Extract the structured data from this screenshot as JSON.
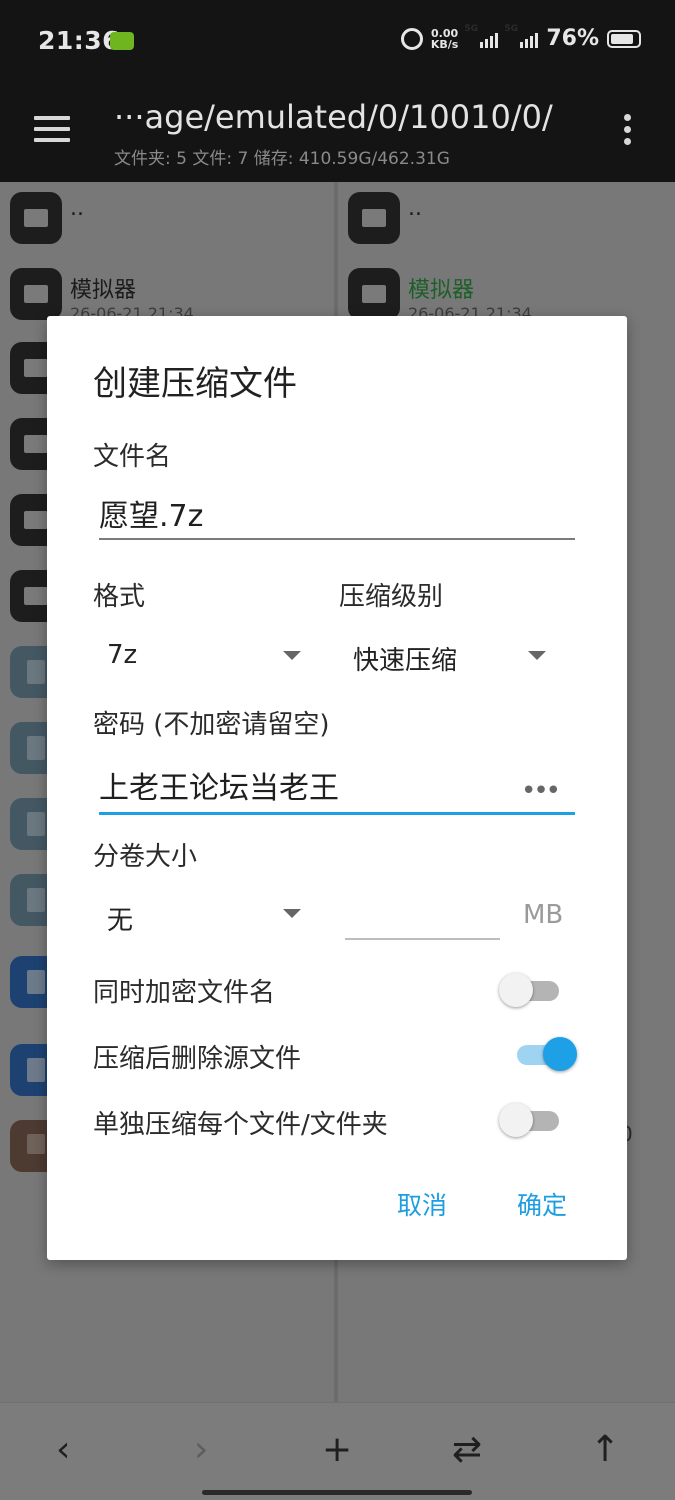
{
  "status": {
    "time": "21:36",
    "net_speed": "0.00",
    "net_unit": "KB/s",
    "sim1": "5G",
    "sim2": "5G",
    "battery": "76%"
  },
  "toolbar": {
    "path": "···age/emulated/0/10010/0/",
    "info": "文件夹: 5  文件: 7  储存: 410.59G/462.31G"
  },
  "left_pane": {
    "items": [
      {
        "name": "..",
        "date": ""
      },
      {
        "name": "模拟器",
        "date": "26-06-21 21:34"
      }
    ]
  },
  "right_pane": {
    "items": [
      {
        "name": "..",
        "date": ""
      },
      {
        "name": "模拟器",
        "date": "26-06-21 21:34"
      }
    ],
    "fragment": "0"
  },
  "dialog": {
    "title": "创建压缩文件",
    "filename_label": "文件名",
    "filename_value": "愿望.7z",
    "format_label": "格式",
    "format_value": "7z",
    "level_label": "压缩级别",
    "level_value": "快速压缩",
    "password_label": "密码 (不加密请留空)",
    "password_value": "上老王论坛当老王",
    "split_label": "分卷大小",
    "split_value": "无",
    "split_unit": "MB",
    "encrypt_names_label": "同时加密文件名",
    "encrypt_names_on": false,
    "delete_source_label": "压缩后删除源文件",
    "delete_source_on": true,
    "separate_label": "单独压缩每个文件/文件夹",
    "separate_on": false,
    "cancel_label": "取消",
    "ok_label": "确定"
  },
  "colors": {
    "accent": "#1ea0e6",
    "folder_name_highlight": "#1d5f28"
  }
}
